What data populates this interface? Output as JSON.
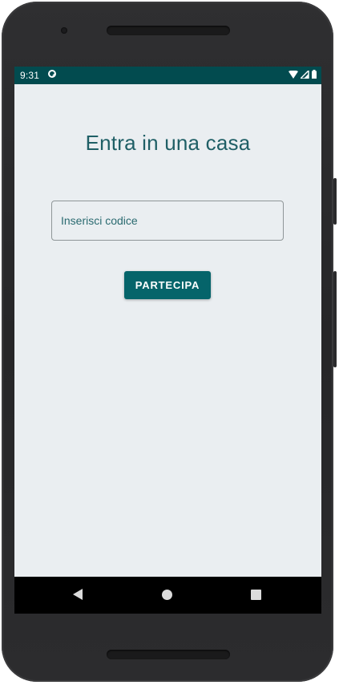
{
  "status_bar": {
    "time": "9:31",
    "icons": [
      "sync-icon",
      "wifi-icon",
      "signal-icon",
      "battery-icon"
    ],
    "background_color": "#024b4f"
  },
  "main": {
    "title": "Entra in una casa",
    "code_input": {
      "value": "",
      "placeholder": "Inserisci codice"
    },
    "join_button_label": "PARTECIPA"
  },
  "navigation_bar": {
    "buttons": [
      "back-icon",
      "home-icon",
      "recents-icon"
    ]
  },
  "colors": {
    "accent": "#05646a",
    "title_text": "#1f5f66",
    "screen_background": "#eaeef1"
  }
}
